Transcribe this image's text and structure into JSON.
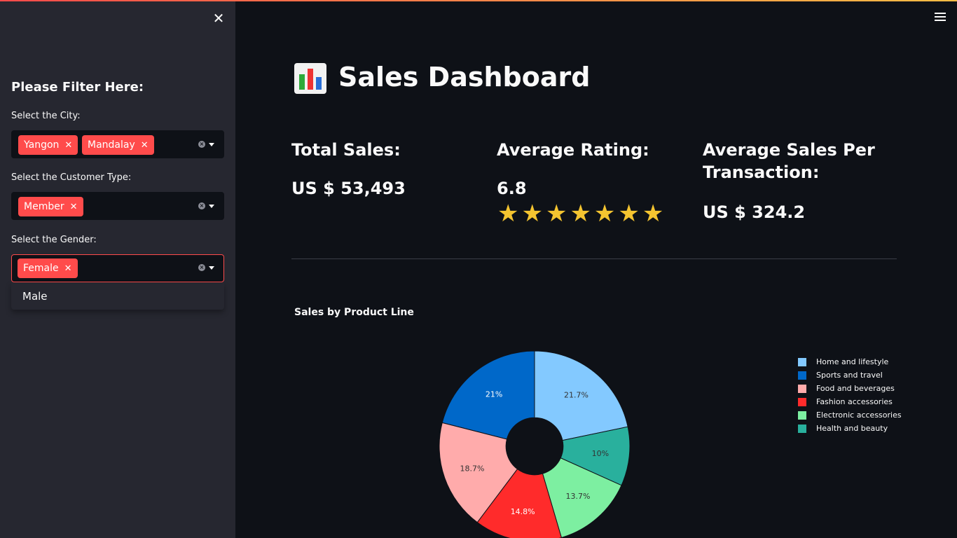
{
  "sidebar": {
    "title": "Please Filter Here:",
    "city": {
      "label": "Select the City:",
      "selected": [
        "Yangon",
        "Mandalay"
      ]
    },
    "customer_type": {
      "label": "Select the Customer Type:",
      "selected": [
        "Member"
      ]
    },
    "gender": {
      "label": "Select the Gender:",
      "selected": [
        "Female"
      ],
      "dropdown_options": [
        "Male"
      ]
    },
    "close_icon": "close-icon"
  },
  "main": {
    "title": "Sales Dashboard",
    "title_icon": "bar-chart-emoji",
    "kpis": {
      "total_sales_label": "Total Sales:",
      "total_sales_value": "US $ 53,493",
      "avg_rating_label": "Average Rating:",
      "avg_rating_value": "6.8",
      "avg_rating_stars": "★★★★★★★",
      "avg_sales_label_line1": "Average Sales Per",
      "avg_sales_label_line2": "Transaction:",
      "avg_sales_value": "US $ 324.2"
    }
  },
  "colors": {
    "accent": "#ff4b4b",
    "background": "#0e1117",
    "sidebar": "#262730",
    "star": "#f4c430"
  },
  "chart_data": {
    "type": "pie",
    "title": "Sales by Product Line",
    "hole": 0.3,
    "legend_position": "right",
    "slices": [
      {
        "name": "Home and lifestyle",
        "percent": 21.7,
        "label": "21.7%",
        "color": "#83c9ff",
        "label_color": "#333333"
      },
      {
        "name": "Health and beauty",
        "percent": 10,
        "label": "10%",
        "color": "#29b09d",
        "label_color": "#333333"
      },
      {
        "name": "Electronic accessories",
        "percent": 13.7,
        "label": "13.7%",
        "color": "#7defa1",
        "label_color": "#333333"
      },
      {
        "name": "Fashion accessories",
        "percent": 14.8,
        "label": "14.8%",
        "color": "#ff2b2b",
        "label_color": "#ffffff"
      },
      {
        "name": "Food and beverages",
        "percent": 18.7,
        "label": "18.7%",
        "color": "#ffabab",
        "label_color": "#333333"
      },
      {
        "name": "Sports and travel",
        "percent": 21,
        "label": "21%",
        "color": "#0068c9",
        "label_color": "#ffffff"
      }
    ],
    "legend_order": [
      "Home and lifestyle",
      "Sports and travel",
      "Food and beverages",
      "Fashion accessories",
      "Electronic accessories",
      "Health and beauty"
    ]
  }
}
